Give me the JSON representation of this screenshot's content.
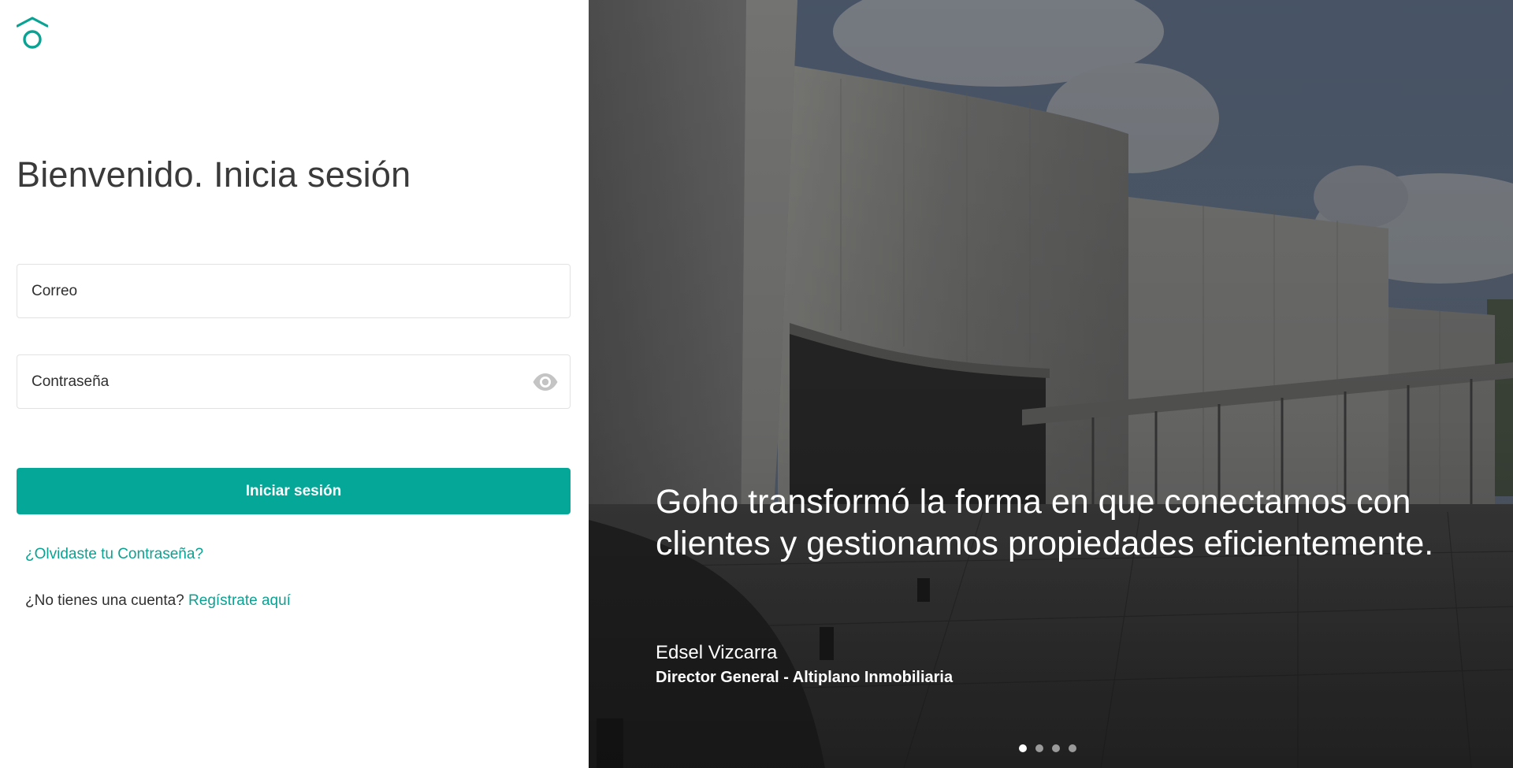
{
  "brand": {
    "logo_icon": "goho-house-logo-icon",
    "accent_color": "#05a898"
  },
  "login": {
    "title": "Bienvenido. Inicia sesión",
    "email_placeholder": "Correo",
    "password_placeholder": "Contraseña",
    "password_toggle_icon": "eye-icon",
    "submit_label": "Iniciar sesión",
    "forgot_link": "¿Olvidaste tu Contraseña?",
    "no_account_text": "¿No tienes una cuenta?",
    "signup_link": "Regístrate aquí"
  },
  "testimonial": {
    "quote": "Goho transformó la forma en que conectamos con clientes y gestionamos propiedades eficientemente.",
    "author": "Edsel Vizcarra",
    "role": "Director General - Altiplano Inmobiliaria"
  },
  "carousel": {
    "slides": 4,
    "active_index": 0
  }
}
